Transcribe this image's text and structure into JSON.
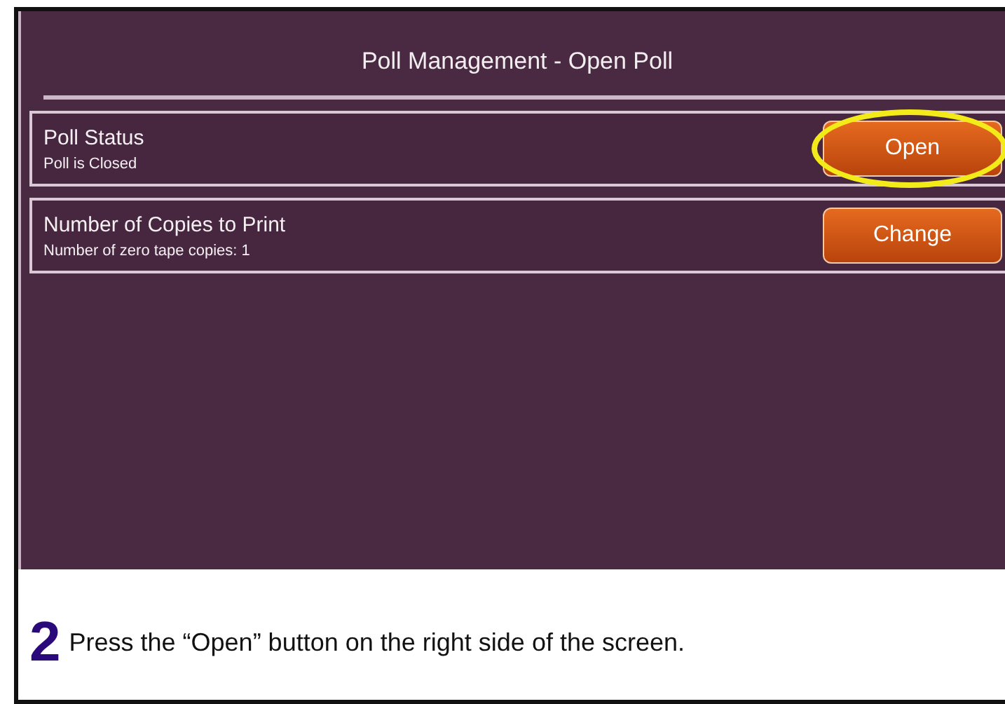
{
  "screen": {
    "title": "Poll Management - Open Poll",
    "rows": [
      {
        "label": "Poll Status",
        "detail": "Poll is Closed",
        "button": "Open",
        "highlighted": true
      },
      {
        "label": "Number of Copies to Print",
        "detail": "Number of zero tape copies: 1",
        "button": "Change",
        "highlighted": false
      }
    ]
  },
  "caption": {
    "step": "2",
    "text": "Press the “Open” button on the right side of the screen."
  }
}
